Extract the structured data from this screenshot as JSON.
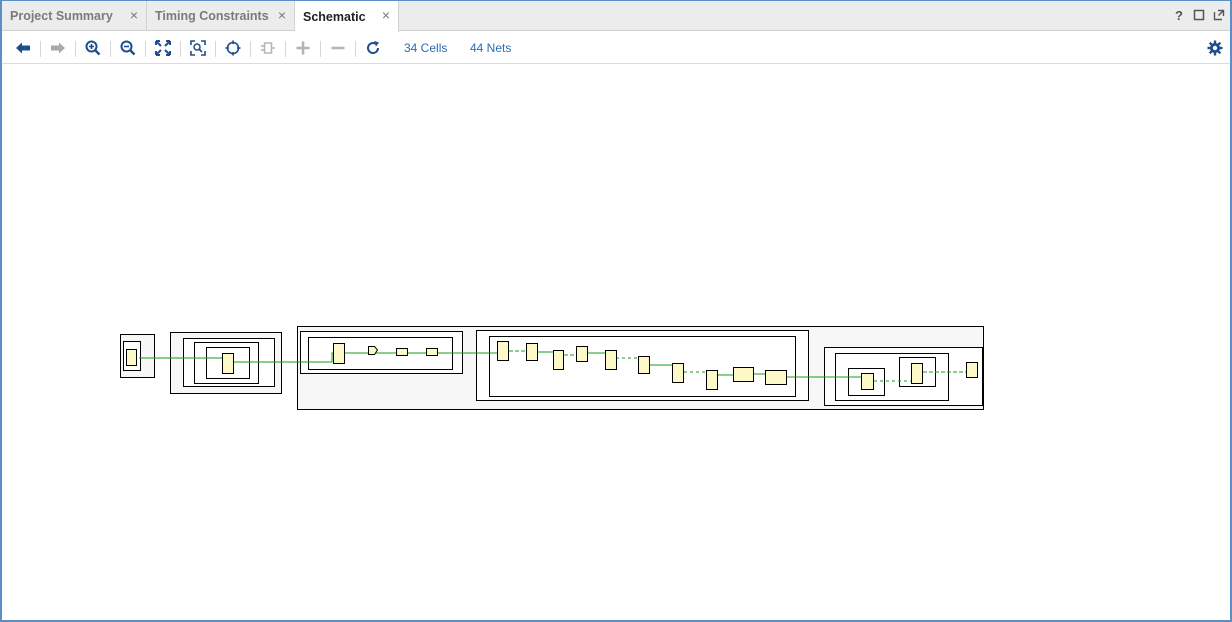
{
  "tabs": [
    {
      "label": "Project Summary",
      "active": false
    },
    {
      "label": "Timing Constraints",
      "active": false
    },
    {
      "label": "Schematic",
      "active": true
    }
  ],
  "window_controls": {
    "help": "?",
    "restore_icon": "restore-icon",
    "float_icon": "float-icon"
  },
  "toolbar": {
    "cells_link": "34 Cells",
    "nets_link": "44 Nets",
    "icons": [
      "back-arrow-icon",
      "forward-arrow-icon",
      "zoom-in-icon",
      "zoom-out-icon",
      "zoom-fit-icon",
      "zoom-area-icon",
      "select-area-icon",
      "route-icon",
      "expand-plus-icon",
      "collapse-minus-icon",
      "refresh-icon",
      "gear-icon"
    ]
  },
  "colors": {
    "accent": "#2d6bb8",
    "net_line": "#1a9b1a",
    "cell_fill": "#fdf8c8",
    "hier_fill": "#f7f7f7",
    "frame_border": "#5b8fc7"
  }
}
